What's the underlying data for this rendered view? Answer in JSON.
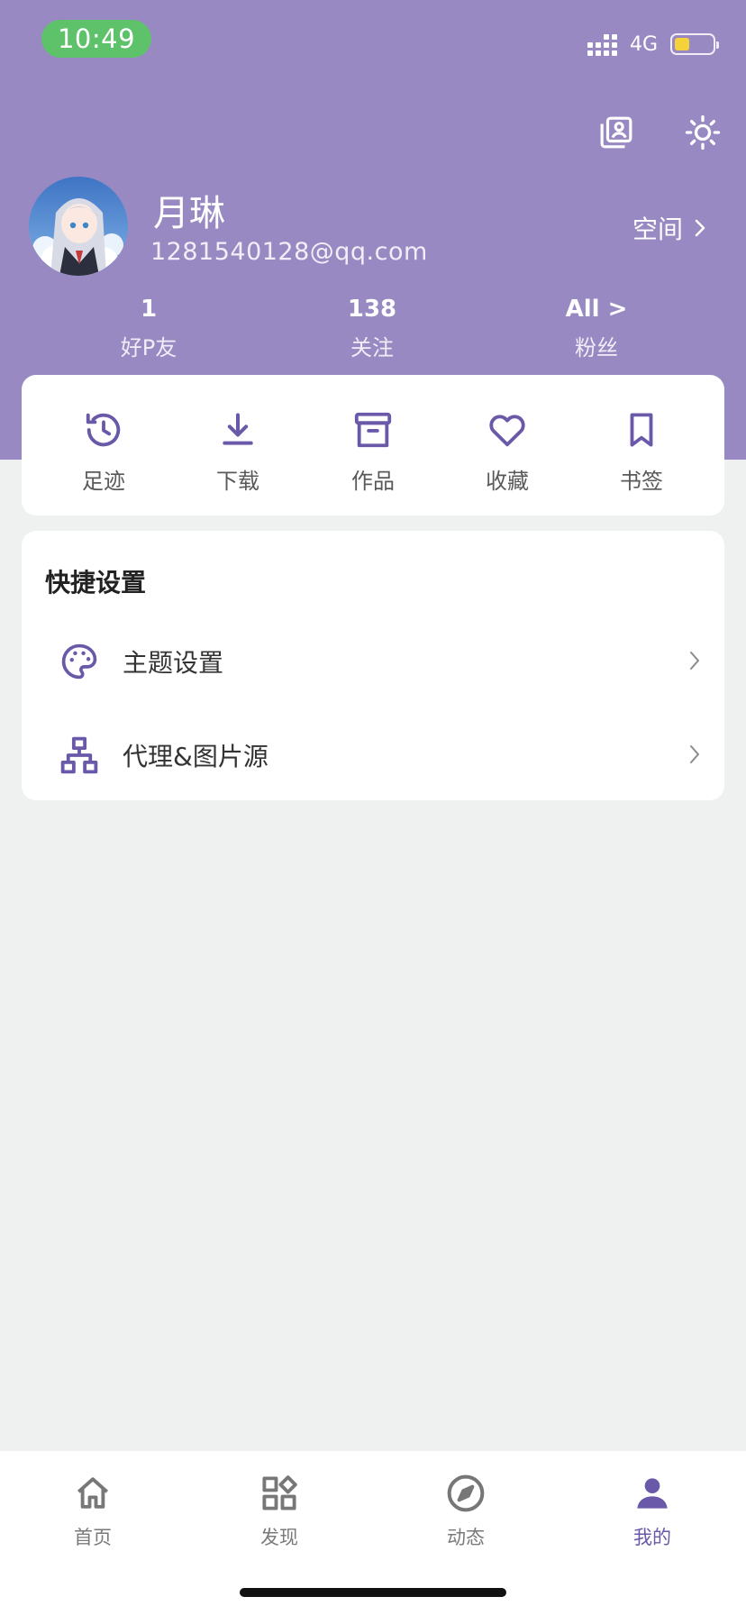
{
  "status_bar": {
    "time": "10:49",
    "network": "4G",
    "battery_level": 0.4,
    "time_pill_color": "#5dc26a"
  },
  "colors": {
    "accent": "#6a58a8",
    "header_bg": "#9889c3",
    "page_bg": "#eff0f0"
  },
  "header": {
    "icons": [
      "profile-card-icon",
      "sun-icon"
    ]
  },
  "profile": {
    "name": "月琳",
    "email": "1281540128@qq.com",
    "space_label": "空间"
  },
  "stats": [
    {
      "value": "1",
      "label": "好P友"
    },
    {
      "value": "138",
      "label": "关注"
    },
    {
      "value": "All >",
      "label": "粉丝"
    }
  ],
  "quick_actions": [
    {
      "icon": "history-icon",
      "label": "足迹"
    },
    {
      "icon": "download-icon",
      "label": "下载"
    },
    {
      "icon": "archive-icon",
      "label": "作品"
    },
    {
      "icon": "heart-icon",
      "label": "收藏"
    },
    {
      "icon": "bookmark-icon",
      "label": "书签"
    }
  ],
  "settings": {
    "title": "快捷设置",
    "items": [
      {
        "icon": "palette-icon",
        "label": "主题设置"
      },
      {
        "icon": "sitemap-icon",
        "label": "代理&图片源"
      }
    ]
  },
  "bottom_nav": {
    "active": "我的",
    "items": [
      {
        "icon": "home-icon",
        "label": "首页"
      },
      {
        "icon": "discover-icon",
        "label": "发现"
      },
      {
        "icon": "compass-icon",
        "label": "动态"
      },
      {
        "icon": "user-icon",
        "label": "我的"
      }
    ]
  }
}
